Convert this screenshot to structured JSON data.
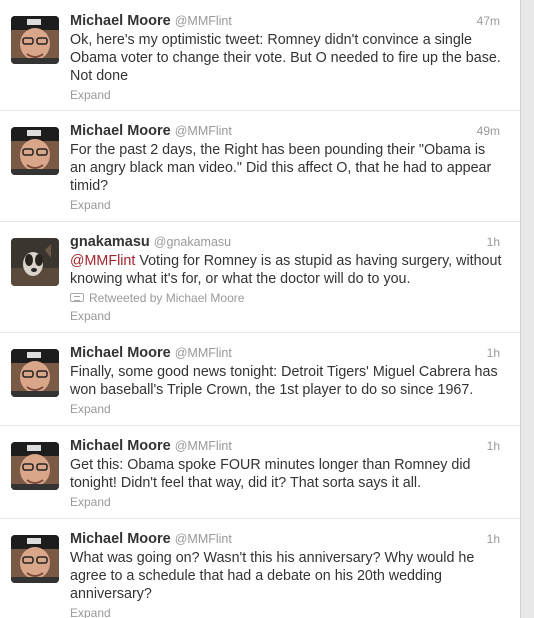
{
  "tweets": [
    {
      "fullname": "Michael Moore",
      "username": "@MMFlint",
      "time": "47m",
      "text": "Ok, here's my optimistic tweet: Romney didn't convince a single Obama voter to change their vote. But O needed to fire up the base. Not done",
      "expand": "Expand",
      "avatar": "michael-moore"
    },
    {
      "fullname": "Michael Moore",
      "username": "@MMFlint",
      "time": "49m",
      "text": "For the past 2 days, the Right has been pounding their \"Obama is an angry black man video.\" Did this affect O, that he had to appear timid?",
      "expand": "Expand",
      "avatar": "michael-moore"
    },
    {
      "fullname": "gnakamasu",
      "username": "@gnakamasu",
      "time": "1h",
      "mention": "@MMFlint",
      "text": " Voting for Romney is as stupid as having surgery, without knowing what it's for, or what the doctor will do to you.",
      "retweeted_by": "Retweeted by Michael Moore",
      "expand": "Expand",
      "avatar": "dog"
    },
    {
      "fullname": "Michael Moore",
      "username": "@MMFlint",
      "time": "1h",
      "text": "Finally, some good news tonight: Detroit Tigers' Miguel Cabrera has won baseball's Triple Crown, the 1st player to do so since 1967.",
      "expand": "Expand",
      "avatar": "michael-moore"
    },
    {
      "fullname": "Michael Moore",
      "username": "@MMFlint",
      "time": "1h",
      "text": "Get this: Obama spoke FOUR minutes longer than Romney did tonight! Didn't feel that way, did it? That sorta says it all.",
      "expand": "Expand",
      "avatar": "michael-moore"
    },
    {
      "fullname": "Michael Moore",
      "username": "@MMFlint",
      "time": "1h",
      "text": "What was going on? Wasn't this his anniversary? Why would he agree to a schedule that had a debate on his 20th wedding anniversary?",
      "expand": "Expand",
      "avatar": "michael-moore"
    }
  ]
}
